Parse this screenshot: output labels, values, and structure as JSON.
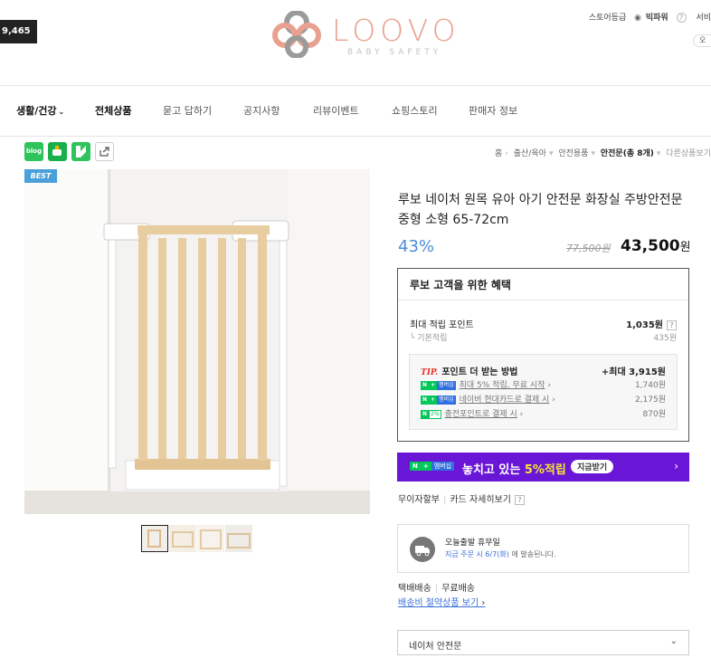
{
  "header": {
    "count_badge": "9,465",
    "logo_word": "LOOVO",
    "logo_sub": "BABY SAFETY",
    "store_grade_label": "스토어등급",
    "store_grade_name": "빅파워",
    "help_mark": "?",
    "extra_label": "서비",
    "small_button": "오"
  },
  "nav": {
    "items": [
      "생활/건강",
      "전체상품",
      "묻고 답하기",
      "공지사항",
      "리뷰이벤트",
      "쇼핑스토리",
      "판매자 정보"
    ]
  },
  "share": {
    "blog": "blog",
    "icons": [
      "blog-share-icon",
      "cafe-share-icon",
      "talk-share-icon",
      "url-share-icon"
    ]
  },
  "breadcrumb": {
    "items": [
      "홈",
      "출산/육아",
      "안전용품",
      "안전문(총 8개)"
    ],
    "more": "다른상품보기"
  },
  "product": {
    "badge": "BEST",
    "title": "루보 네이처 원목 유아 아기 안전문 화장실 주방안전문 중형 소형 65-72cm",
    "discount": "43%",
    "original_price": "77,500원",
    "sale_price_num": "43,500",
    "sale_price_unit": "원"
  },
  "benefit": {
    "title": "루보 고객을 위한 혜택",
    "max_points_label": "최대 적립 포인트",
    "max_points_value": "1,035원",
    "basic_label": "기본적립",
    "basic_value": "435원",
    "help_mark": "?",
    "tip_tag": "TIP.",
    "tip_title": "포인트 더 받는 방법",
    "tip_max": "+최대 3,915원",
    "tip_rows": [
      {
        "label": "최대 5% 적립, 무료 시작",
        "value": "1,740원"
      },
      {
        "label": "네이버 현대카드로 결제 시",
        "value": "2,175원"
      },
      {
        "label": "충전포인트로 결제 시",
        "value": "870원"
      }
    ],
    "badge_n": "N",
    "badge_plus": "+",
    "badge_member": "멤버십",
    "badge_pct": "2%"
  },
  "promo": {
    "text_prefix": "놓치고 있는 ",
    "text_highlight": "5%적립",
    "button": "지금받기",
    "arrow": "›"
  },
  "payment": {
    "interest_free": "무이자할부",
    "card_detail": "카드 자세히보기",
    "help_mark": "?"
  },
  "shipping": {
    "title": "오늘출발 휴무일",
    "sub_blue": "지금 주문 시 6/7(화)",
    "sub_rest": " 에 발송된니다."
  },
  "delivery": {
    "type": "택배배송",
    "fee": "무료배송",
    "save_link": "배송비 절약상품 보기",
    "save_arrow": "›"
  },
  "option": {
    "selected": "네이처 안전문",
    "chevron": "⌄"
  },
  "colors": {
    "accent_blue": "#4a8dd6",
    "promo_purple": "#6a16d6",
    "naver_green": "#03c75a",
    "logo_pink": "#e8a08f"
  }
}
